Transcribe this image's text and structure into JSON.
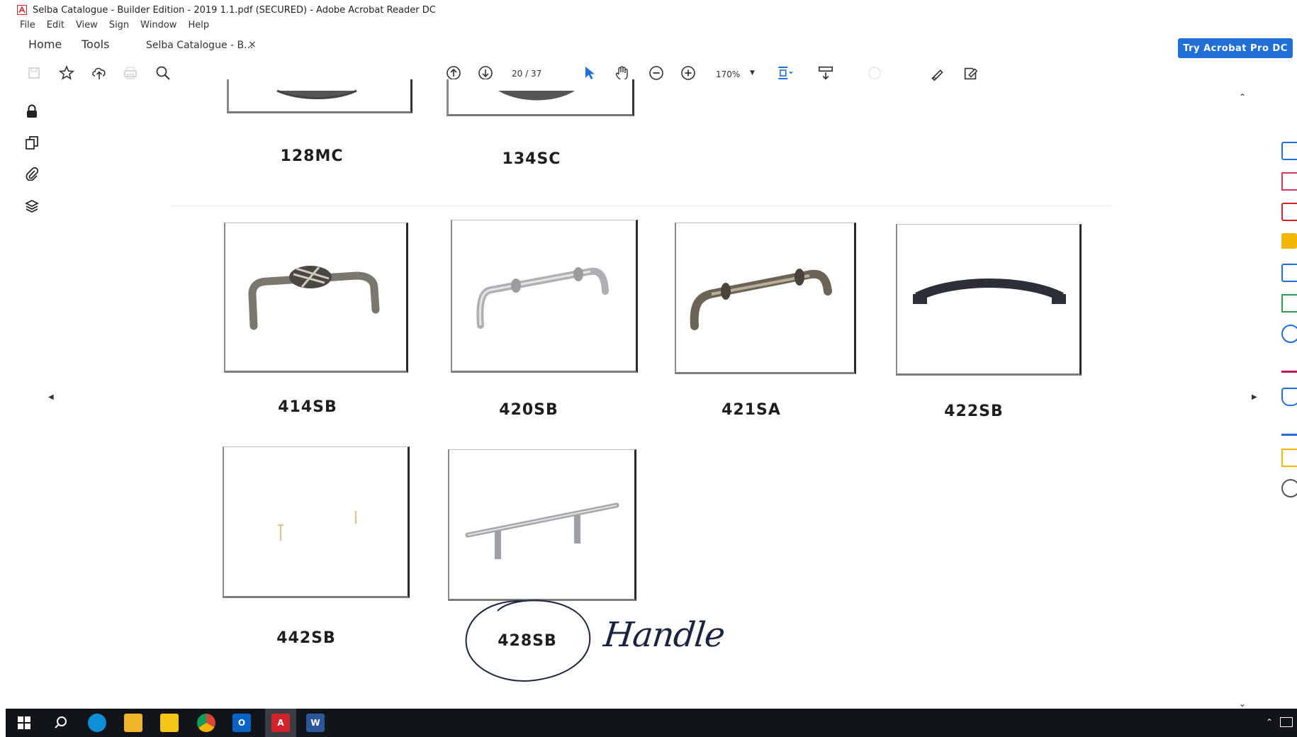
{
  "window": {
    "title": "Selba Catalogue - Builder Edition - 2019 1.1.pdf (SECURED) - Adobe Acrobat Reader DC"
  },
  "menu": [
    "File",
    "Edit",
    "View",
    "Sign",
    "Window",
    "Help"
  ],
  "tabs": {
    "home": "Home",
    "tools": "Tools",
    "document": "Selba Catalogue - B...",
    "close": "×"
  },
  "try_pro": "Try Acrobat Pro DC",
  "toolbar": {
    "page_current": "20",
    "page_total": "37",
    "page_display": "20  /  37",
    "zoom": "170%",
    "icons": [
      "save-icon",
      "bookmark-star-icon",
      "upload-cloud-icon",
      "print-icon",
      "search-zoom-icon",
      "page-up-icon",
      "page-down-icon",
      "select-cursor-icon",
      "hand-tool-icon",
      "zoom-out-icon",
      "zoom-in-icon",
      "fit-page-icon",
      "scroll-mode-icon",
      "share-icon",
      "fill-sign-icon",
      "edit-icon"
    ]
  },
  "products": {
    "row0": [
      "128MC",
      "134SC"
    ],
    "row1": [
      "414SB",
      "420SB",
      "421SA",
      "422SB"
    ],
    "row2": [
      "442SB",
      "428SB"
    ]
  },
  "annotation": {
    "handwritten": "Handle",
    "circled": "428SB"
  },
  "colors": {
    "accent": "#1f6fd6",
    "acrobat_red": "#d2232a",
    "taskbar": "#111418"
  }
}
